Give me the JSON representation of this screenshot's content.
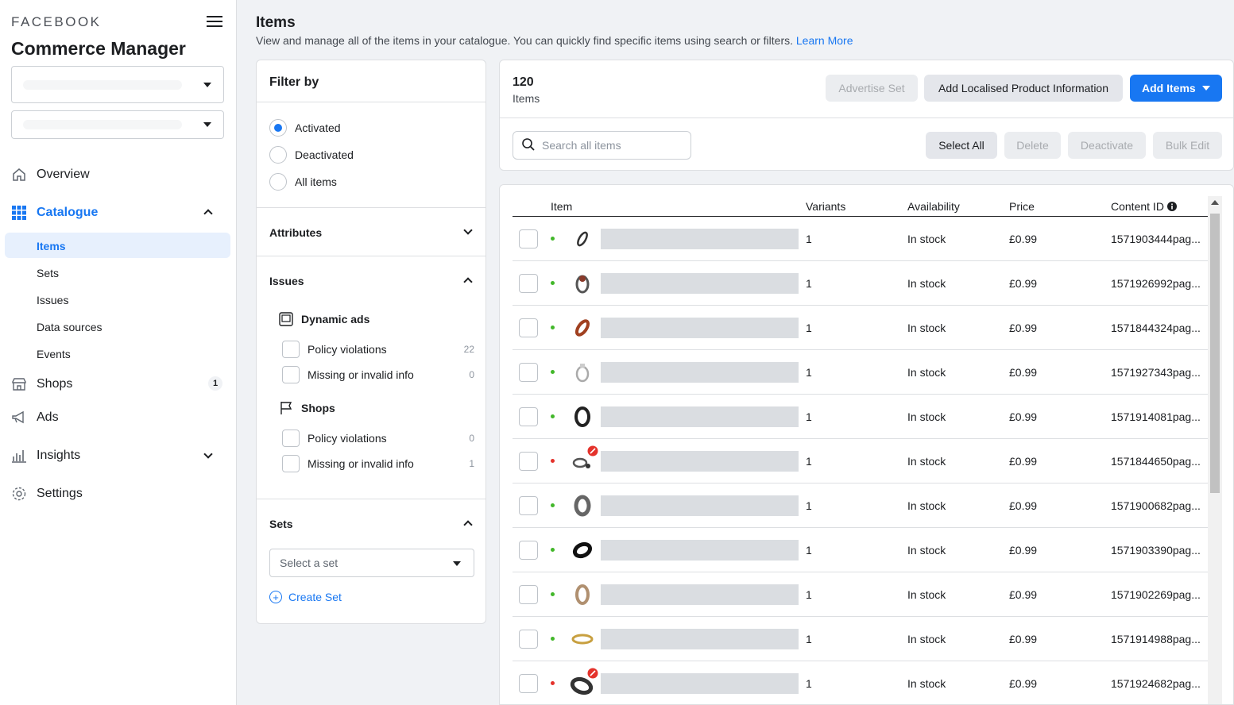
{
  "sidebar": {
    "brand": "FACEBOOK",
    "app_title": "Commerce Manager",
    "nav": [
      {
        "label": "Overview",
        "icon": "home-icon"
      },
      {
        "label": "Catalogue",
        "icon": "grid-icon"
      },
      {
        "label": "Shops",
        "icon": "store-icon",
        "badge": "1"
      },
      {
        "label": "Ads",
        "icon": "megaphone-icon"
      },
      {
        "label": "Insights",
        "icon": "bar-chart-icon"
      },
      {
        "label": "Settings",
        "icon": "gear-icon"
      }
    ],
    "catalogue_sub": [
      "Items",
      "Sets",
      "Issues",
      "Data sources",
      "Events"
    ]
  },
  "header": {
    "title": "Items",
    "description": "View and manage all of the items in your catalogue. You can quickly find specific items using search or filters.",
    "learn_more": "Learn More"
  },
  "filter": {
    "title": "Filter by",
    "status_options": [
      "Activated",
      "Deactivated",
      "All items"
    ],
    "selected_status": "Activated",
    "attributes_label": "Attributes",
    "issues_label": "Issues",
    "dynamic_ads_label": "Dynamic ads",
    "shops_label": "Shops",
    "dynamic_ads_issues": [
      {
        "label": "Policy violations",
        "count": "22"
      },
      {
        "label": "Missing or invalid info",
        "count": "0"
      }
    ],
    "shops_issues": [
      {
        "label": "Policy violations",
        "count": "0"
      },
      {
        "label": "Missing or invalid info",
        "count": "1"
      }
    ],
    "sets_label": "Sets",
    "set_placeholder": "Select a set",
    "create_set": "Create Set"
  },
  "toolbar": {
    "count": "120",
    "count_label": "Items",
    "advertise_set": "Advertise Set",
    "add_localised": "Add Localised Product Information",
    "add_items": "Add Items",
    "search_placeholder": "Search all items",
    "select_all": "Select All",
    "delete": "Delete",
    "deactivate": "Deactivate",
    "bulk_edit": "Bulk Edit"
  },
  "table": {
    "headers": {
      "item": "Item",
      "variants": "Variants",
      "availability": "Availability",
      "price": "Price",
      "content_id": "Content ID"
    },
    "rows": [
      {
        "status": "green",
        "variants": "1",
        "availability": "In stock",
        "price": "£0.99",
        "content_id": "1571903444pag..."
      },
      {
        "status": "green",
        "variants": "1",
        "availability": "In stock",
        "price": "£0.99",
        "content_id": "1571926992pag..."
      },
      {
        "status": "green",
        "variants": "1",
        "availability": "In stock",
        "price": "£0.99",
        "content_id": "1571844324pag..."
      },
      {
        "status": "green",
        "variants": "1",
        "availability": "In stock",
        "price": "£0.99",
        "content_id": "1571927343pag..."
      },
      {
        "status": "green",
        "variants": "1",
        "availability": "In stock",
        "price": "£0.99",
        "content_id": "1571914081pag..."
      },
      {
        "status": "red",
        "variants": "1",
        "availability": "In stock",
        "price": "£0.99",
        "content_id": "1571844650pag..."
      },
      {
        "status": "green",
        "variants": "1",
        "availability": "In stock",
        "price": "£0.99",
        "content_id": "1571900682pag..."
      },
      {
        "status": "green",
        "variants": "1",
        "availability": "In stock",
        "price": "£0.99",
        "content_id": "1571903390pag..."
      },
      {
        "status": "green",
        "variants": "1",
        "availability": "In stock",
        "price": "£0.99",
        "content_id": "1571902269pag..."
      },
      {
        "status": "green",
        "variants": "1",
        "availability": "In stock",
        "price": "£0.99",
        "content_id": "1571914988pag..."
      },
      {
        "status": "red",
        "variants": "1",
        "availability": "In stock",
        "price": "£0.99",
        "content_id": "1571924682pag..."
      }
    ]
  },
  "colors": {
    "accent": "#1877f2",
    "ok": "#42b72a",
    "error": "#e4322b"
  }
}
